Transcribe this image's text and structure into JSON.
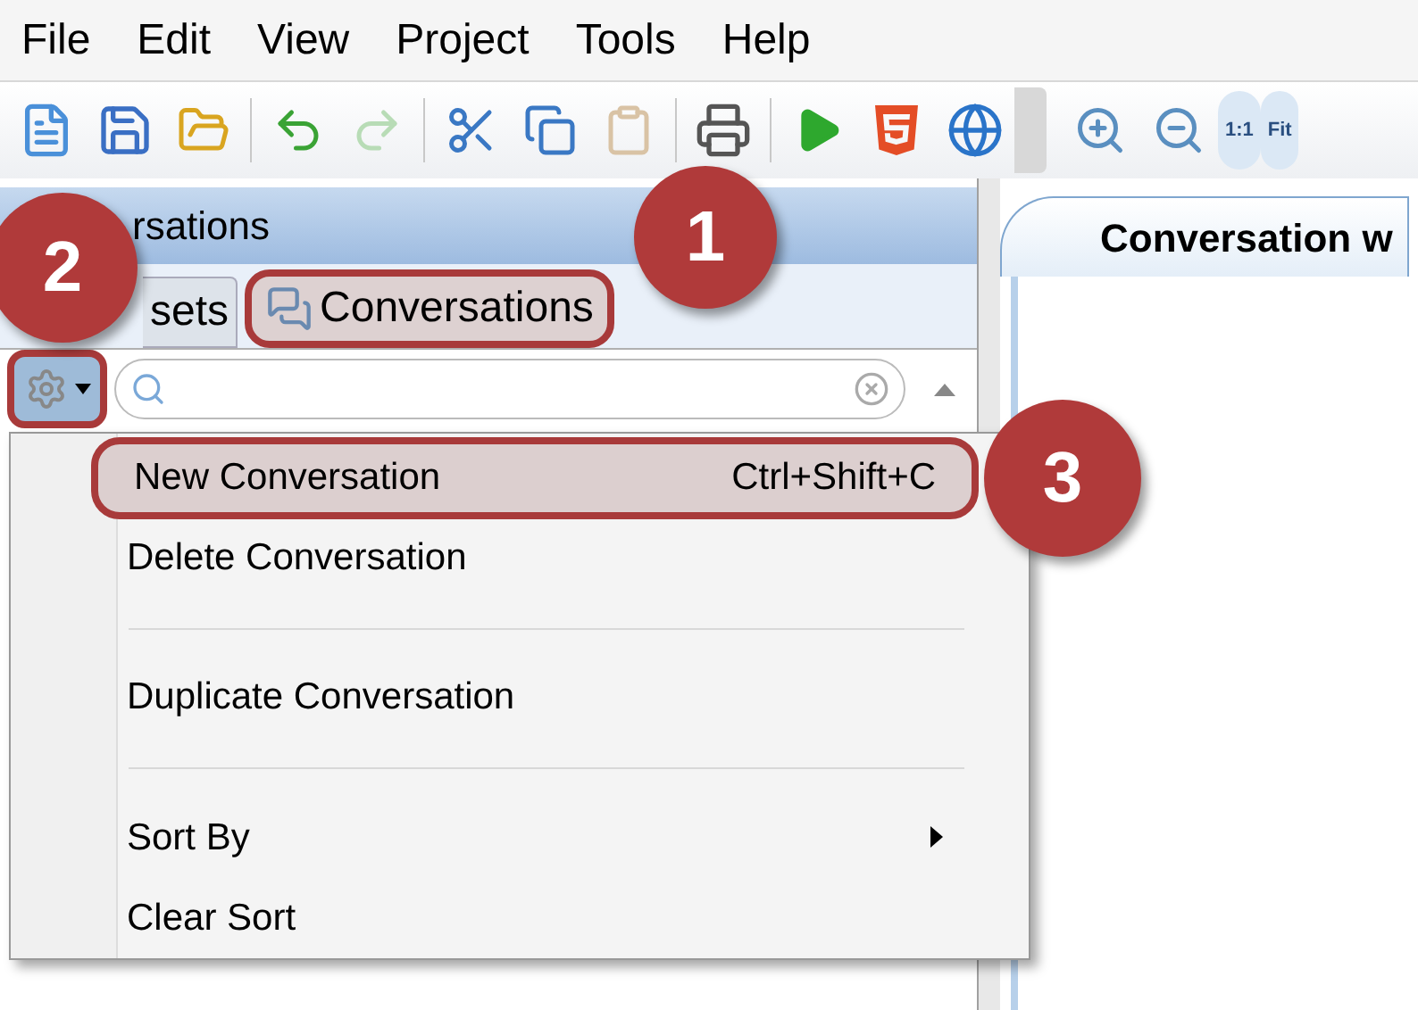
{
  "menu_bar": [
    {
      "label": "File"
    },
    {
      "label": "Edit"
    },
    {
      "label": "View"
    },
    {
      "label": "Project"
    },
    {
      "label": "Tools"
    },
    {
      "label": "Help"
    }
  ],
  "toolbar": {
    "zoom_buttons": [
      {
        "label": "1:1"
      },
      {
        "label": "Fit"
      }
    ]
  },
  "panel": {
    "title": "rsations",
    "tabs": [
      {
        "label": "sets",
        "selected": false
      },
      {
        "label": "Conversations",
        "selected": true
      }
    ]
  },
  "context_menu": [
    {
      "kind": "item",
      "label": "New Conversation",
      "shortcut": "Ctrl+Shift+C",
      "highlighted": true,
      "has_submenu": false
    },
    {
      "kind": "item",
      "label": "Delete Conversation",
      "highlighted": false,
      "has_submenu": false
    },
    {
      "kind": "separator"
    },
    {
      "kind": "item",
      "label": "Duplicate Conversation",
      "highlighted": false,
      "has_submenu": false
    },
    {
      "kind": "separator"
    },
    {
      "kind": "item",
      "label": "Sort By",
      "highlighted": false,
      "has_submenu": true
    },
    {
      "kind": "item",
      "label": "Clear Sort",
      "highlighted": false,
      "has_submenu": false
    }
  ],
  "document_tab": {
    "title": "Conversation w"
  },
  "callouts": [
    {
      "number": "1"
    },
    {
      "number": "2"
    },
    {
      "number": "3"
    }
  ]
}
